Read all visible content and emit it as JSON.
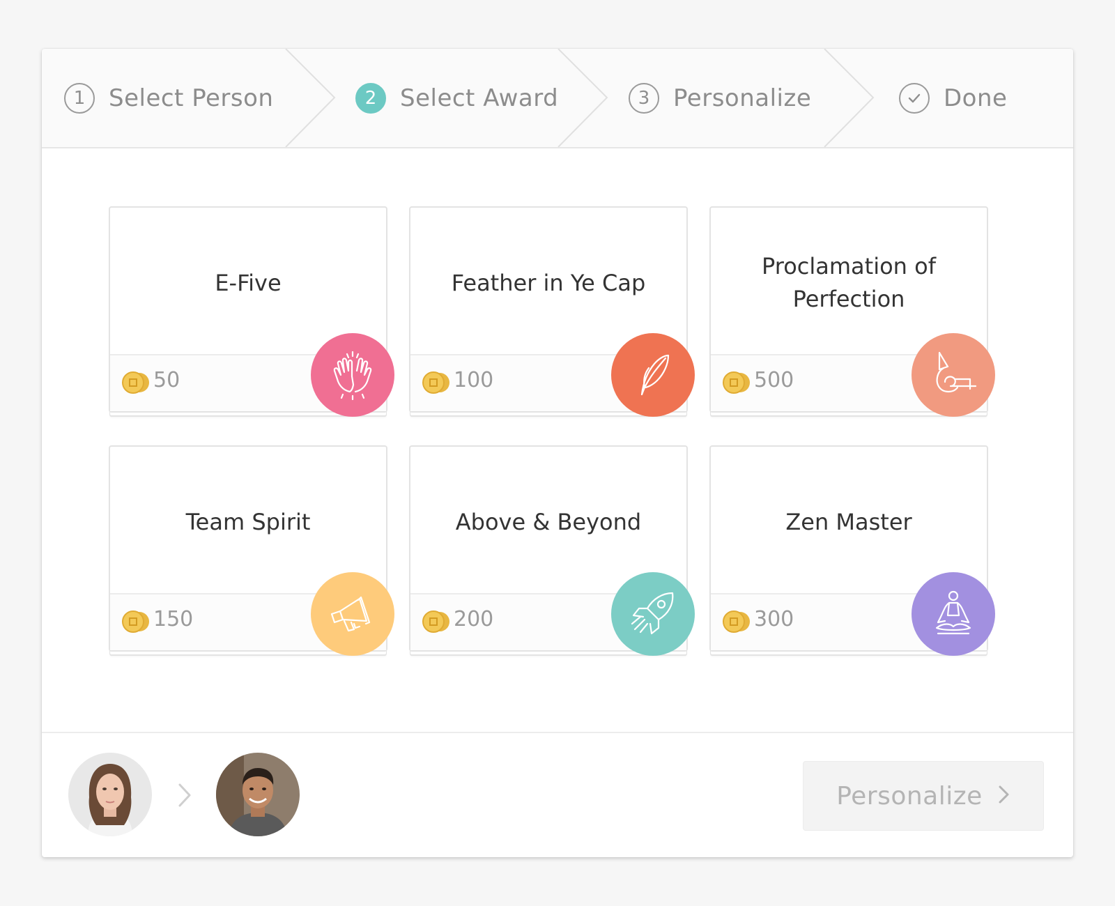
{
  "stepper": {
    "steps": [
      {
        "number": "1",
        "label": "Select Person",
        "state": "complete"
      },
      {
        "number": "2",
        "label": "Select Award",
        "state": "active"
      },
      {
        "number": "3",
        "label": "Personalize",
        "state": "upcoming"
      },
      {
        "number": "",
        "label": "Done",
        "state": "upcoming",
        "icon": "check-icon"
      }
    ],
    "active_color": "#6cc9c3"
  },
  "awards": [
    {
      "name": "E-Five",
      "points": "50",
      "color": "#f06f93",
      "icon": "high-five-icon"
    },
    {
      "name": "Feather in Ye Cap",
      "points": "100",
      "color": "#ef7352",
      "icon": "feather-icon"
    },
    {
      "name": "Proclamation of Perfection",
      "points": "500",
      "color": "#f19a80",
      "icon": "horn-icon"
    },
    {
      "name": "Team Spirit",
      "points": "150",
      "color": "#fecb7b",
      "icon": "megaphone-icon"
    },
    {
      "name": "Above & Beyond",
      "points": "200",
      "color": "#7ccdc5",
      "icon": "rocket-icon"
    },
    {
      "name": "Zen Master",
      "points": "300",
      "color": "#a290e0",
      "icon": "meditation-icon"
    }
  ],
  "coin_color": "#f3c957",
  "footer": {
    "sender_avatar": "avatar-woman",
    "recipient_avatar": "avatar-man",
    "next_button_label": "Personalize"
  }
}
